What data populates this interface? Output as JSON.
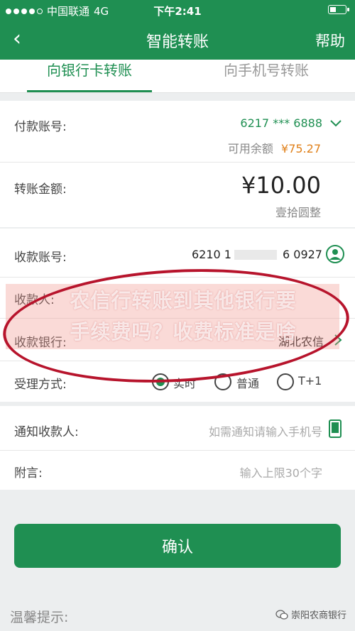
{
  "status_bar": {
    "carrier": "中国联通",
    "network": "4G",
    "time": "下午2:41"
  },
  "nav": {
    "back_icon": "‹",
    "title": "智能转账",
    "help": "帮助"
  },
  "tabs": [
    {
      "label": "向银行卡转账",
      "active": true
    },
    {
      "label": "向手机号转账",
      "active": false
    }
  ],
  "payment": {
    "account_label": "付款账号:",
    "account_value": "6217 *** 6888",
    "balance_label": "可用余额",
    "balance_value": "¥75.27",
    "amount_label": "转账金额:",
    "amount_value": "¥10.00",
    "amount_words": "壹拾圆整"
  },
  "payee": {
    "account_label": "收款账号:",
    "account_start": "6210 1",
    "account_end": "6 0927",
    "name_label": "收款人:",
    "bank_label": "收款银行:",
    "bank_value": "湖北农信",
    "method_label": "受理方式:",
    "methods": [
      {
        "label": "实时",
        "checked": true
      },
      {
        "label": "普通",
        "checked": false
      },
      {
        "label": "T+1",
        "checked": false
      }
    ]
  },
  "extra": {
    "notify_label": "通知收款人:",
    "notify_placeholder": "如需通知请输入手机号",
    "remark_label": "附言:",
    "remark_placeholder": "输入上限30个字"
  },
  "confirm_label": "确认",
  "tips_label": "温馨提示:",
  "watermark_text": "崇阳农商银行",
  "overlay": {
    "line1": "农信行转账到其他银行要",
    "line2": "手续费吗？收费标准是啥"
  },
  "colors": {
    "brand": "#1f8f52",
    "balance": "#e0801a",
    "circle": "#b7142c"
  }
}
